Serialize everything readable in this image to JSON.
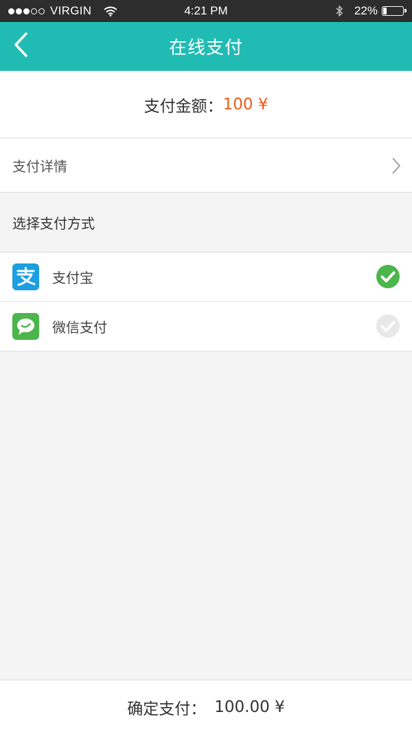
{
  "status_bar": {
    "carrier": "VIRGIN",
    "time": "4:21 PM",
    "battery_percent": "22%",
    "battery_level": 0.22,
    "signal_bars_filled": 3,
    "signal_bars_total": 5
  },
  "nav": {
    "title": "在线支付",
    "back_icon": "chevron-left-icon"
  },
  "amount": {
    "label": "支付金额：",
    "value": "100 ¥"
  },
  "detail": {
    "label": "支付详情",
    "icon": "chevron-right-icon"
  },
  "payment_section": {
    "header": "选择支付方式",
    "options": [
      {
        "label": "支付宝",
        "icon": "alipay-icon",
        "selected": true
      },
      {
        "label": "微信支付",
        "icon": "wechat-icon",
        "selected": false
      }
    ]
  },
  "confirm": {
    "label": "确定支付：",
    "amount": "100.00 ¥"
  },
  "colors": {
    "accent": "#20bcb4",
    "price": "#ec5a1e",
    "alipay": "#1c9ee0",
    "wechat": "#4cb54b",
    "check_selected": "#4cb54b",
    "check_unselected": "#e8e8e8"
  }
}
